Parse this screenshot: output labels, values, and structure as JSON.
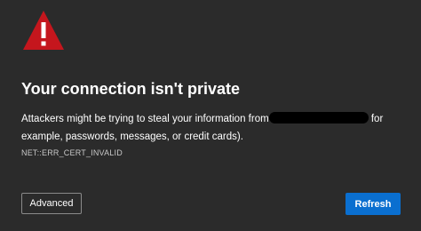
{
  "colors": {
    "background": "#2b2b2b",
    "warning_red": "#c5161d",
    "accent_blue": "#0a6fd0",
    "text": "#ffffff"
  },
  "warning": {
    "icon": "warning-triangle-icon"
  },
  "title": "Your connection isn't private",
  "description": {
    "before": "Attackers might be trying to steal your information from",
    "after": " for example, passwords, messages, or credit cards)."
  },
  "error_code": "NET::ERR_CERT_INVALID",
  "buttons": {
    "advanced": "Advanced",
    "refresh": "Refresh"
  }
}
